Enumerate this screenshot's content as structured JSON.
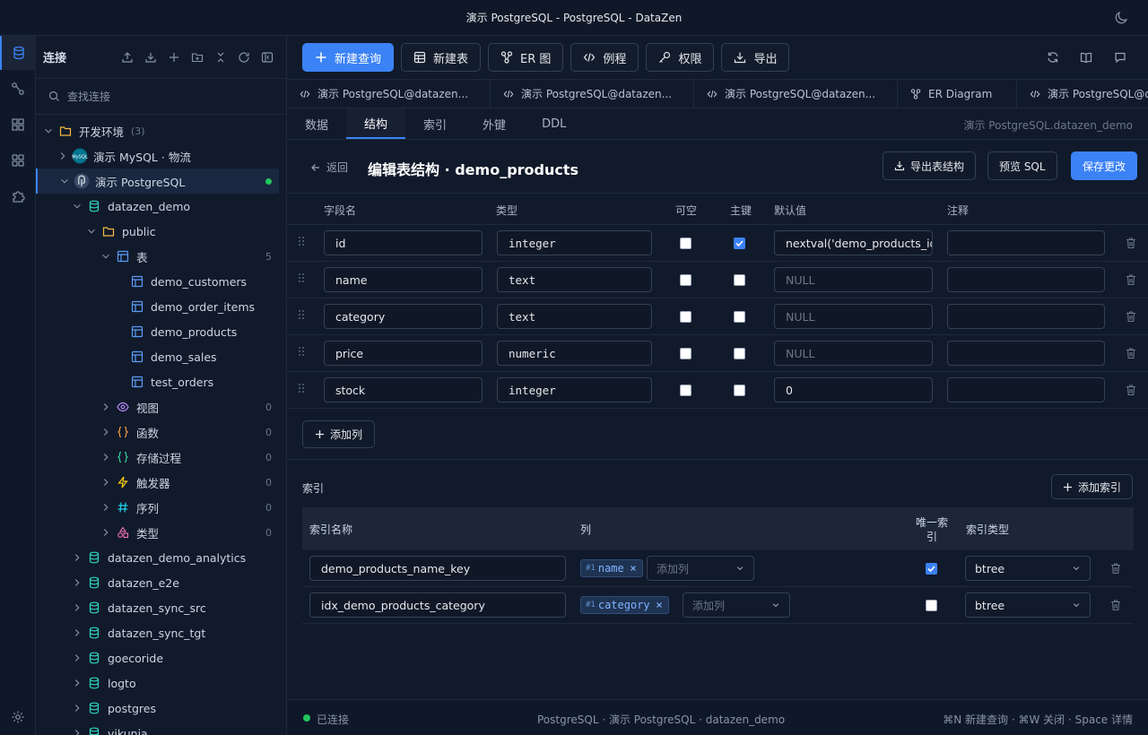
{
  "window": {
    "title": "演示 PostgreSQL - PostgreSQL - DataZen"
  },
  "sidebar": {
    "title": "连接",
    "search_placeholder": "查找连接",
    "tree": [
      {
        "label": "开发环境",
        "count": "(3)",
        "icon": "folder-icon",
        "level": 0,
        "open": true
      },
      {
        "label": "演示 MySQL · 物流",
        "icon": "mysql-icon",
        "level": 1,
        "open": false
      },
      {
        "label": "演示 PostgreSQL",
        "icon": "postgres-icon",
        "level": 1,
        "open": true,
        "selected": true,
        "connected": true
      },
      {
        "label": "datazen_demo",
        "icon": "database-icon",
        "level": 2,
        "open": true
      },
      {
        "label": "public",
        "icon": "folder-icon",
        "level": 3,
        "open": true
      },
      {
        "label": "表",
        "count": "5",
        "icon": "table-icon",
        "level": 4,
        "open": true
      },
      {
        "label": "demo_customers",
        "icon": "table-icon",
        "level": 5
      },
      {
        "label": "demo_order_items",
        "icon": "table-icon",
        "level": 5
      },
      {
        "label": "demo_products",
        "icon": "table-icon",
        "level": 5
      },
      {
        "label": "demo_sales",
        "icon": "table-icon",
        "level": 5
      },
      {
        "label": "test_orders",
        "icon": "table-icon",
        "level": 5
      },
      {
        "label": "视图",
        "count": "0",
        "icon": "eye-icon",
        "level": 4,
        "open": false
      },
      {
        "label": "函数",
        "count": "0",
        "icon": "braces-icon",
        "level": 4,
        "open": false
      },
      {
        "label": "存储过程",
        "count": "0",
        "icon": "braces-green-icon",
        "level": 4,
        "open": false
      },
      {
        "label": "触发器",
        "count": "0",
        "icon": "bolt-icon",
        "level": 4,
        "open": false
      },
      {
        "label": "序列",
        "count": "0",
        "icon": "hash-icon",
        "level": 4,
        "open": false
      },
      {
        "label": "类型",
        "count": "0",
        "icon": "shapes-icon",
        "level": 4,
        "open": false
      },
      {
        "label": "datazen_demo_analytics",
        "icon": "database-icon",
        "level": 2,
        "open": false
      },
      {
        "label": "datazen_e2e",
        "icon": "database-icon",
        "level": 2,
        "open": false
      },
      {
        "label": "datazen_sync_src",
        "icon": "database-icon",
        "level": 2,
        "open": false
      },
      {
        "label": "datazen_sync_tgt",
        "icon": "database-icon",
        "level": 2,
        "open": false
      },
      {
        "label": "goecoride",
        "icon": "database-icon",
        "level": 2,
        "open": false
      },
      {
        "label": "logto",
        "icon": "database-icon",
        "level": 2,
        "open": false
      },
      {
        "label": "postgres",
        "icon": "database-icon",
        "level": 2,
        "open": false
      },
      {
        "label": "vikunja",
        "icon": "database-icon",
        "level": 2,
        "open": false
      }
    ]
  },
  "toolbar": {
    "new_query": "新建查询",
    "new_table": "新建表",
    "er_diagram": "ER 图",
    "routines": "例程",
    "permissions": "权限",
    "export": "导出"
  },
  "tabs": [
    {
      "label": "演示 PostgreSQL@datazen...",
      "icon": "code-icon"
    },
    {
      "label": "演示 PostgreSQL@datazen...",
      "icon": "code-icon"
    },
    {
      "label": "演示 PostgreSQL@datazen...",
      "icon": "code-icon"
    },
    {
      "label": "ER Diagram",
      "icon": "er-icon"
    },
    {
      "label": "演示 PostgreSQL@da",
      "icon": "code-icon"
    }
  ],
  "subtabs": {
    "items": [
      "数据",
      "结构",
      "索引",
      "外键",
      "DDL"
    ],
    "active": 1,
    "path": "演示 PostgreSQL.datazen_demo"
  },
  "editor": {
    "back": "返回",
    "title": "编辑表结构 · demo_products",
    "export_structure": "导出表结构",
    "preview_sql": "预览 SQL",
    "save": "保存更改",
    "headers": {
      "name": "字段名",
      "type": "类型",
      "nullable": "可空",
      "pk": "主键",
      "default": "默认值",
      "comment": "注释"
    },
    "columns": [
      {
        "name": "id",
        "type": "integer",
        "nullable": false,
        "pk": true,
        "default": "nextval('demo_products_id",
        "default_is_placeholder": false,
        "comment": ""
      },
      {
        "name": "name",
        "type": "text",
        "nullable": false,
        "pk": false,
        "default": "NULL",
        "default_is_placeholder": true,
        "comment": ""
      },
      {
        "name": "category",
        "type": "text",
        "nullable": false,
        "pk": false,
        "default": "NULL",
        "default_is_placeholder": true,
        "comment": ""
      },
      {
        "name": "price",
        "type": "numeric",
        "nullable": false,
        "pk": false,
        "default": "NULL",
        "default_is_placeholder": true,
        "comment": ""
      },
      {
        "name": "stock",
        "type": "integer",
        "nullable": false,
        "pk": false,
        "default": "0",
        "default_is_placeholder": false,
        "comment": ""
      }
    ],
    "add_column": "添加列"
  },
  "indexes": {
    "label": "索引",
    "add_index": "添加索引",
    "headers": {
      "name": "索引名称",
      "columns": "列",
      "unique_1": "唯一索",
      "unique_2": "引",
      "type": "索引类型"
    },
    "add_column_placeholder": "添加列",
    "rows": [
      {
        "name": "demo_products_name_key",
        "chip_prefix": "#1",
        "column": "name",
        "unique": true,
        "type": "btree"
      },
      {
        "name": "idx_demo_products_category",
        "chip_prefix": "#1",
        "column": "category",
        "unique": false,
        "type": "btree"
      }
    ]
  },
  "status": {
    "connected": "已连接",
    "center": "PostgreSQL · 演示 PostgreSQL · datazen_demo",
    "right": "⌘N 新建查询 · ⌘W 关闭 · Space 详情"
  },
  "colors": {
    "accent": "#3b82f6",
    "connected": "#22c55e",
    "db": "#2dd4bf",
    "folder": "#f5b942"
  }
}
